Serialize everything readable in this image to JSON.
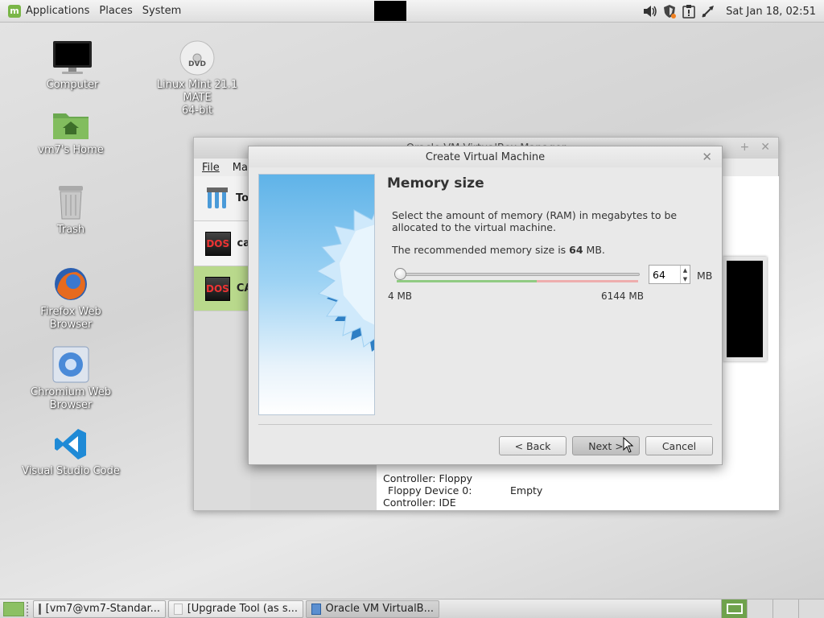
{
  "top_panel": {
    "menus": [
      "Applications",
      "Places",
      "System"
    ],
    "clock": "Sat Jan 18, 02:51",
    "tray_icons": [
      "volume-icon",
      "shield-icon",
      "clipboard-alert-icon",
      "network-icon"
    ]
  },
  "desktop_icons": [
    {
      "label": "Computer",
      "icon": "computer-icon"
    },
    {
      "label": "Linux Mint 21.1 MATE\n64-bit",
      "icon": "dvd-icon"
    },
    {
      "label": "vm7's Home",
      "icon": "home-folder-icon"
    },
    {
      "label": "Trash",
      "icon": "trash-icon"
    },
    {
      "label": "Firefox Web Browser",
      "icon": "firefox-icon"
    },
    {
      "label": "Chromium Web Browser",
      "icon": "chromium-icon"
    },
    {
      "label": "Visual Studio Code",
      "icon": "vscode-icon"
    }
  ],
  "vbox_manager": {
    "title": "Oracle VM VirtualBox Manager",
    "menus": [
      "File",
      "Ma"
    ],
    "entries": [
      "To",
      "ca",
      "CA"
    ],
    "storage": {
      "controller_floppy": "Controller: Floppy",
      "floppy_device": "Floppy Device 0:",
      "floppy_value": "Empty",
      "controller_ide": "Controller: IDE"
    }
  },
  "dialog": {
    "title": "Create Virtual Machine",
    "heading": "Memory size",
    "description": "Select the amount of memory (RAM) in megabytes to be allocated to the virtual machine.",
    "recommended_prefix": "The recommended memory size is ",
    "recommended_value": "64",
    "recommended_suffix": " MB.",
    "memory_value": "64",
    "memory_unit": "MB",
    "slider_min": "4 MB",
    "slider_max": "6144 MB",
    "slider_fraction": 0.01,
    "buttons": {
      "back": "< Back",
      "next": "Next >",
      "cancel": "Cancel"
    }
  },
  "taskbar": {
    "items": [
      "[vm7@vm7-Standar...",
      "[Upgrade Tool (as s...",
      "Oracle VM VirtualB..."
    ]
  },
  "colors": {
    "accent": "#7ab648",
    "selected_vm": "#b9d98c"
  }
}
